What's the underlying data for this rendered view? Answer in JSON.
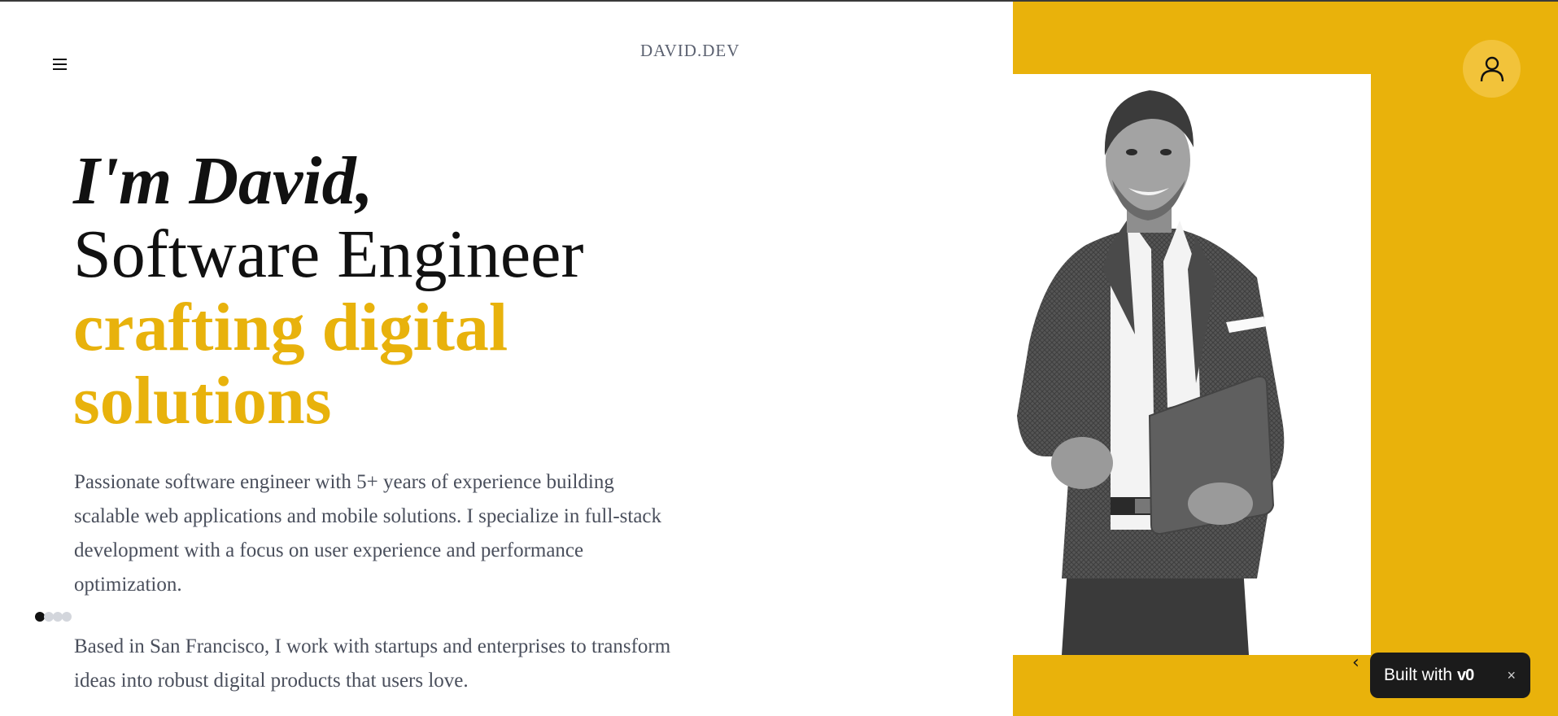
{
  "header": {
    "brand": "DAVID.DEV",
    "menu_icon": "hamburger-menu-icon",
    "profile_icon": "user-icon"
  },
  "hero": {
    "line1": "I'm David,",
    "line2": "Software Engineer",
    "line3": "crafting digital solutions",
    "paragraph1": "Passionate software engineer with 5+ years of experience building scalable web applications and mobile solutions. I specialize in full-stack development with a focus on user experience and performance optimization.",
    "paragraph2": "Based in San Francisco, I work with startups and enterprises to transform ideas into robust digital products that users love."
  },
  "pagination": {
    "count": 4,
    "active_index": 0
  },
  "toast": {
    "label": "Built with",
    "logo": "v0",
    "close": "×"
  },
  "colors": {
    "accent": "#e9b20b",
    "text_dark": "#111111",
    "text_muted": "#4a4f5c",
    "brand_gray": "#5b6170",
    "toast_bg": "#1b1b1b"
  }
}
